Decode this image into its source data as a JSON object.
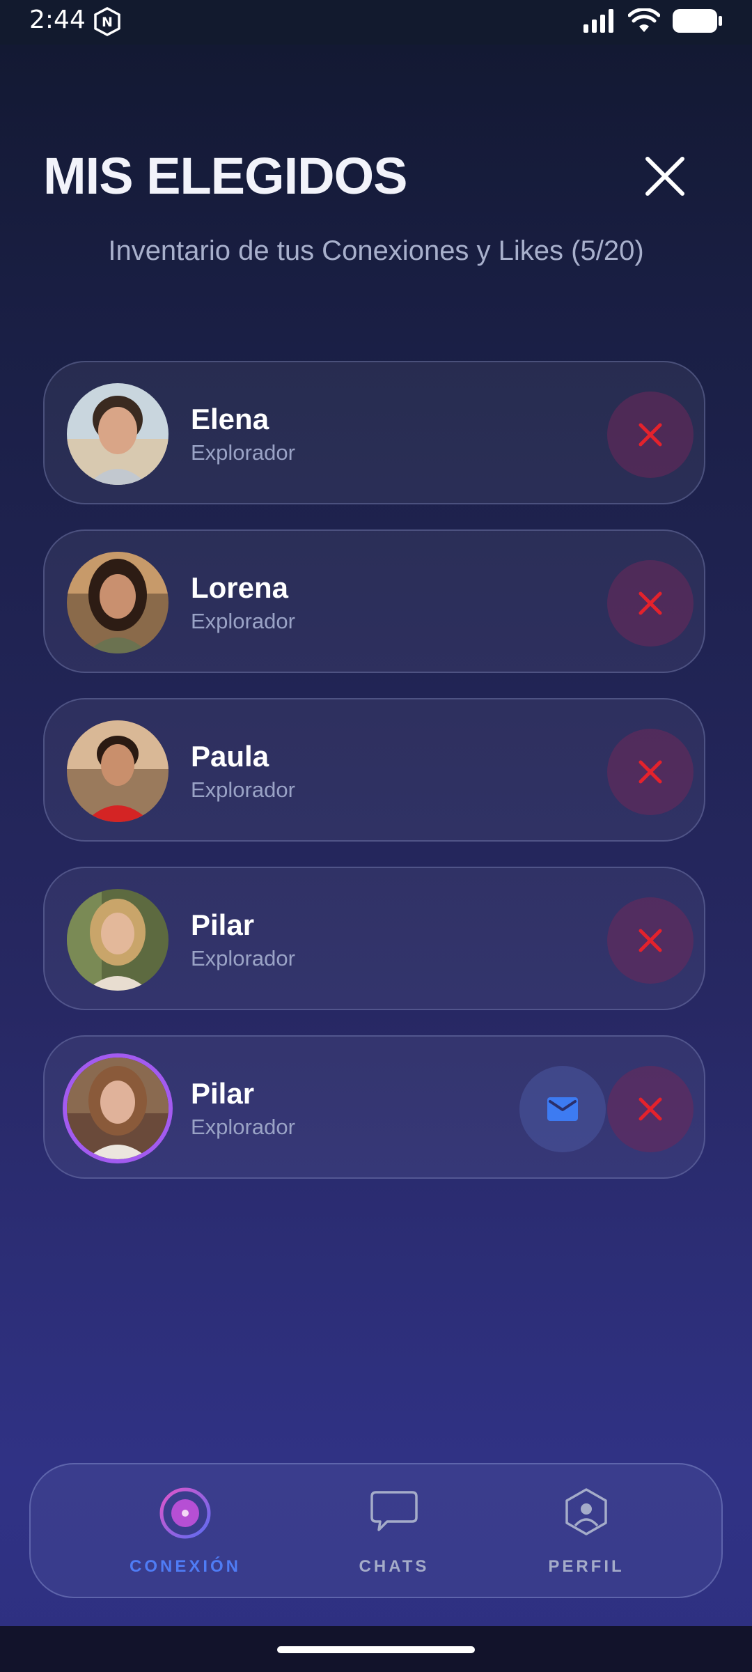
{
  "status_bar": {
    "time": "2:44"
  },
  "header": {
    "title": "MIS ELEGIDOS",
    "subtitle": "Inventario de tus Conexiones y Likes (5/20)"
  },
  "connections": [
    {
      "name": "Elena",
      "role": "Explorador",
      "avatar": "avatar-photo-elena"
    },
    {
      "name": "Lorena",
      "role": "Explorador",
      "avatar": "avatar-photo-lorena"
    },
    {
      "name": "Paula",
      "role": "Explorador",
      "avatar": "avatar-photo-paula"
    },
    {
      "name": "Pilar",
      "role": "Explorador",
      "avatar": "avatar-photo-pilar"
    },
    {
      "name": "Pilar",
      "role": "Explorador",
      "avatar": "avatar-photo-pilar-2",
      "has_message_button": true
    }
  ],
  "nav": {
    "items": [
      {
        "label": "CONEXIÓN",
        "icon": "target-icon",
        "active": true
      },
      {
        "label": "CHATS",
        "icon": "chat-bubble-icon",
        "active": false
      },
      {
        "label": "PERFIL",
        "icon": "profile-hex-icon",
        "active": false
      }
    ]
  },
  "colors": {
    "accent_active": "#4f7cf5",
    "inactive_nav": "#a5acc9",
    "remove_x": "#e4222c",
    "mail_icon": "#3d7bf2",
    "avatar_ring": "#a35bf0"
  }
}
